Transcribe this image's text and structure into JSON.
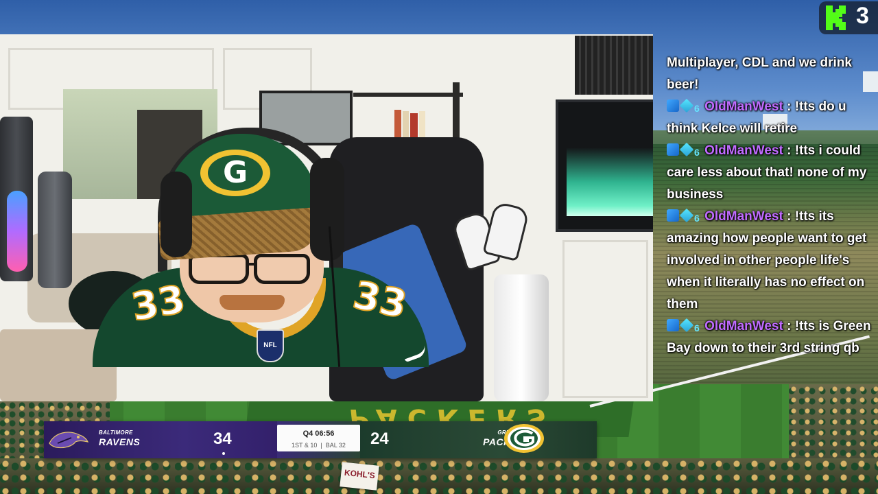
{
  "chat": {
    "messages": [
      {
        "text": "Multiplayer, CDL and we drink beer!"
      },
      {
        "username": "OldManWest",
        "text": "!tts do u think Kelce will retire"
      },
      {
        "username": "OldManWest",
        "text": "!tts i could care less about that! none of my business"
      },
      {
        "username": "OldManWest",
        "text": "!tts its amazing how people want to get involved in other people life's when it literally has no effect on them"
      },
      {
        "username": "OldManWest",
        "text": "!tts is Green Bay down to their 3rd string qb"
      }
    ],
    "separator": ":",
    "badge_gift_label": "6"
  },
  "viewer_count": "3",
  "scoreboard": {
    "away": {
      "city": "BALTIMORE",
      "name": "RAVENS",
      "score": "34"
    },
    "home": {
      "city": "GREEN BAY",
      "name": "PACKERS",
      "score": "24"
    },
    "quarter_clock": "Q4 06:56",
    "down_distance": "1ST & 10",
    "ball_on": "BAL 32"
  },
  "stadium": {
    "endzone_text": "PACKERS",
    "sign_text": "KOHL'S"
  },
  "webcam": {
    "jersey_number": "33",
    "cap_letter": "G",
    "shield_text": "NFL"
  },
  "colors": {
    "kick_green": "#53fc18",
    "chat_username": "#c06bff",
    "ravens_purple": "#2b1b5c",
    "packers_green": "#1c3b2c",
    "packers_gold": "#f1c232"
  },
  "icons": [
    "kick-logo-icon",
    "sword-badge-icon",
    "gem-badge-icon",
    "gift-badge-icon",
    "ravens-logo-icon",
    "packers-logo-icon",
    "nfl-shield-icon",
    "nike-swoosh-icon"
  ]
}
